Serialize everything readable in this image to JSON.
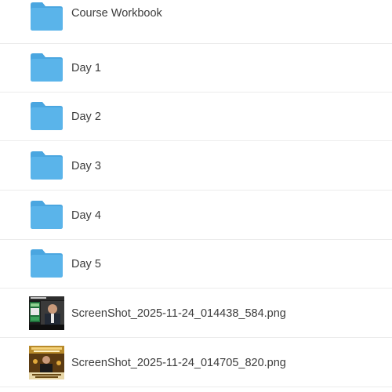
{
  "items": [
    {
      "type": "folder",
      "name": "Course Workbook",
      "icon": "folder-icon"
    },
    {
      "type": "folder",
      "name": "Day 1",
      "icon": "folder-icon"
    },
    {
      "type": "folder",
      "name": "Day 2",
      "icon": "folder-icon"
    },
    {
      "type": "folder",
      "name": "Day 3",
      "icon": "folder-icon"
    },
    {
      "type": "folder",
      "name": "Day 4",
      "icon": "folder-icon"
    },
    {
      "type": "folder",
      "name": "Day 5",
      "icon": "folder-icon"
    },
    {
      "type": "image",
      "name": "ScreenShot_2025-11-24_014438_584.png",
      "icon": "image-thumbnail"
    },
    {
      "type": "image",
      "name": "ScreenShot_2025-11-24_014705_820.png",
      "icon": "image-thumbnail"
    }
  ],
  "colors": {
    "folder": "#5ab4ea",
    "folder_tab": "#4aa6e0",
    "text": "#3c3c3c",
    "divider": "#ececec"
  }
}
